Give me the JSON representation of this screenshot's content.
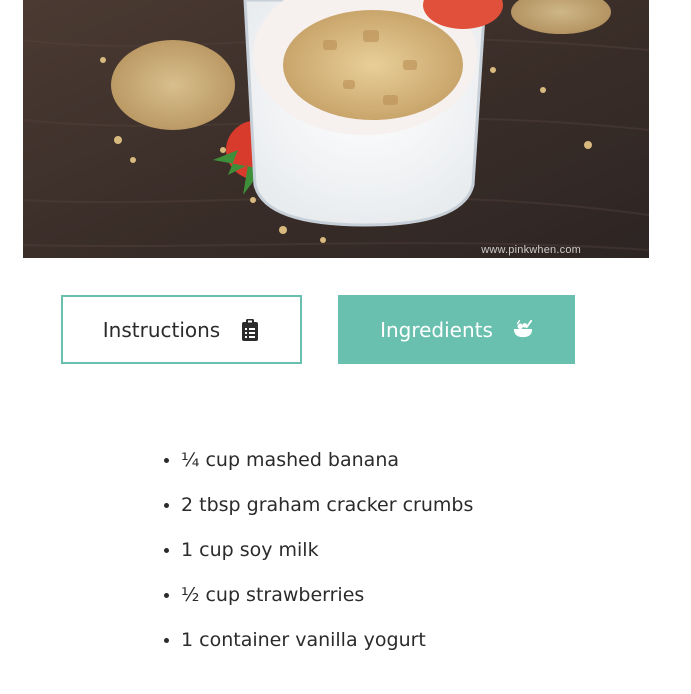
{
  "hero": {
    "watermark": "www.pinkwhen.com"
  },
  "tabs": [
    {
      "label": "Instructions",
      "icon": "clipboard-icon",
      "active": false
    },
    {
      "label": "Ingredients",
      "icon": "salad-bowl-icon",
      "active": true
    }
  ],
  "ingredients": [
    "¼ cup mashed banana",
    "2 tbsp graham cracker crumbs",
    "1 cup soy milk",
    "½ cup strawberries",
    "1 container vanilla yogurt"
  ],
  "colors": {
    "accent": "#69c0ae",
    "text": "#2b2b2b",
    "background": "#ffffff"
  }
}
